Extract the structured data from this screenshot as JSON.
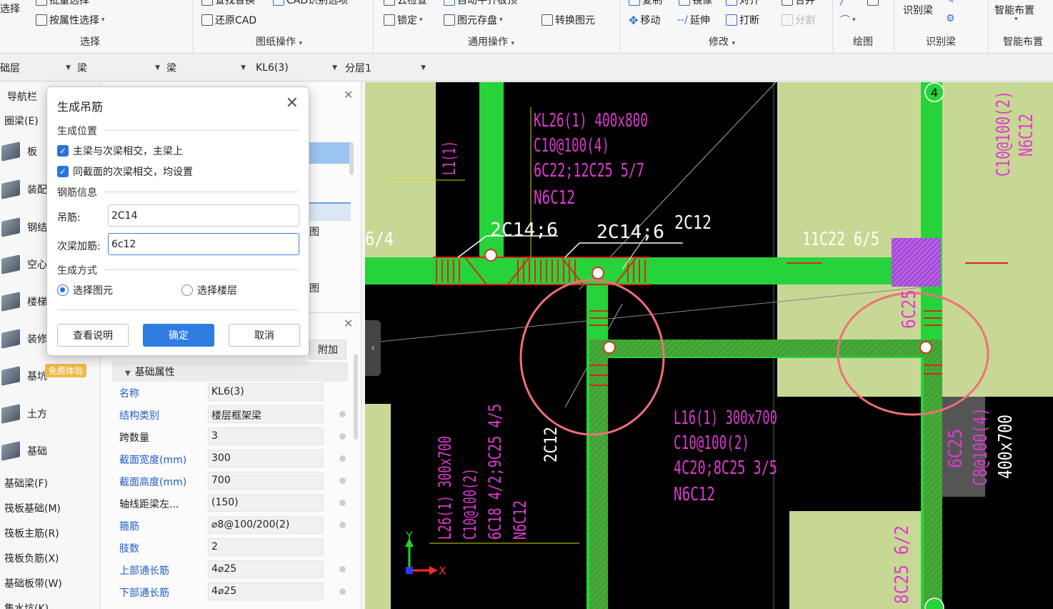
{
  "ribbon": {
    "select_group": {
      "top_partial": "选择",
      "batch_select": "批量选择",
      "by_property": "按属性选择",
      "label": "选择"
    },
    "drawing_ops": {
      "find_replace": "查找替换",
      "cad_recognize": "CAD识别选项",
      "restore_cad": "还原CAD",
      "label": "图纸操作"
    },
    "common_ops": {
      "cloud_check": "云检查",
      "auto_flat": "自动平齐板顶",
      "lock": "锁定",
      "save_element": "图元存盘",
      "convert": "转换图元",
      "label": "通用操作"
    },
    "modify": {
      "copy": "复制",
      "mirror": "镜像",
      "align": "对齐",
      "merge": "合并",
      "move": "移动",
      "extend": "延伸",
      "break": "打断",
      "split": "分割",
      "label": "修改"
    },
    "draw": {
      "label": "绘图"
    },
    "recognize_beam": {
      "btn": "识别梁",
      "label": "识别梁"
    },
    "smart_layout": {
      "btn": "智能布置",
      "label": "智能布置"
    }
  },
  "combobar": {
    "floor": "础层",
    "type1": "梁",
    "type2": "梁",
    "element": "KL6(3)",
    "layer": "分层1"
  },
  "left_panel": {
    "title": "导航栏",
    "ring_beam": "圈梁(E)",
    "categories": [
      "板",
      "装配",
      "钢结",
      "空心",
      "楼梯",
      "装修",
      "基坑",
      "土方",
      "基础"
    ],
    "trial_badge": "免费体验",
    "sub_items": [
      "基础梁(F)",
      "筏板基础(M)",
      "筏板主筋(R)",
      "筏板负筋(X)",
      "基础板带(W)",
      "集水坑(K)"
    ]
  },
  "mid_panel": {
    "tab_label_1": "图",
    "tab_label_2": "图",
    "attach_tab": "附加",
    "section_title": "基础属性",
    "properties": [
      {
        "name": "名称",
        "value": "KL6(3)",
        "blue": true,
        "dot": false
      },
      {
        "name": "结构类别",
        "value": "楼层框架梁",
        "blue": true,
        "dot": true
      },
      {
        "name": "跨数量",
        "value": "3",
        "blue": false,
        "dot": true
      },
      {
        "name": "截面宽度(mm)",
        "value": "300",
        "blue": true,
        "dot": true
      },
      {
        "name": "截面高度(mm)",
        "value": "700",
        "blue": true,
        "dot": true
      },
      {
        "name": "轴线距梁左...",
        "value": "(150)",
        "blue": false,
        "dot": true
      },
      {
        "name": "箍筋",
        "value": "⌀8@100/200(2)",
        "blue": true,
        "dot": true
      },
      {
        "name": "肢数",
        "value": "2",
        "blue": true,
        "dot": false
      },
      {
        "name": "上部通长筋",
        "value": "4⌀25",
        "blue": true,
        "dot": true
      },
      {
        "name": "下部通长筋",
        "value": "4⌀25",
        "blue": true,
        "dot": true
      }
    ]
  },
  "dialog": {
    "title": "生成吊筋",
    "section_position": "生成位置",
    "check1": "主梁与次梁相交，主梁上",
    "check2": "同截面的次梁相交，均设置",
    "section_rebar": "钢筋信息",
    "hanger_label": "吊筋:",
    "hanger_value": "2C14",
    "secondary_label": "次梁加筋:",
    "secondary_value": "6c12",
    "section_method": "生成方式",
    "radio1": "选择图元",
    "radio2": "选择楼层",
    "btn_help": "查看说明",
    "btn_ok": "确定",
    "btn_cancel": "取消"
  },
  "cad": {
    "beam_kl26": [
      "KL26(1) 400x800",
      "C10@100(4)",
      "6C22;12C25 5/7",
      "N6C12"
    ],
    "l1_label": "L1(1)",
    "left_partial": "6/4",
    "hanger_label_1": "2C14;6",
    "hanger_label_2": "2C14;6",
    "label_2c12_top": "2C12",
    "label_11c22": "11C22 6/5",
    "axis_bubble": "4",
    "right_vertical_1": "C10@100(2)",
    "right_vertical_2": "N6C12",
    "label_6c25": "6C25",
    "beam_l16": [
      "L16(1) 300x700",
      "C10@100(2)",
      "4C20;8C25 3/5",
      "N6C12"
    ],
    "label_2c12_vertical": "2C12",
    "beam_l26": [
      "L26(1) 300x700",
      "C10@100(2)",
      "6C18 4/2;9C25 4/5",
      "N6C12"
    ],
    "right_vertical_3": "6C25",
    "right_vertical_4": "C8@100(4)",
    "right_vertical_5": "400x700",
    "bottom_right_label": "8C25 6/2",
    "axis_y": "Y",
    "axis_x": "X"
  },
  "colors": {
    "beam_green": "#27d33a",
    "column_olive": "#c7d895",
    "text_magenta": "#e03ad0",
    "rebar_red": "#e0241b",
    "annotation_circle": "#f26f78",
    "primary_button": "#2f7de1"
  }
}
